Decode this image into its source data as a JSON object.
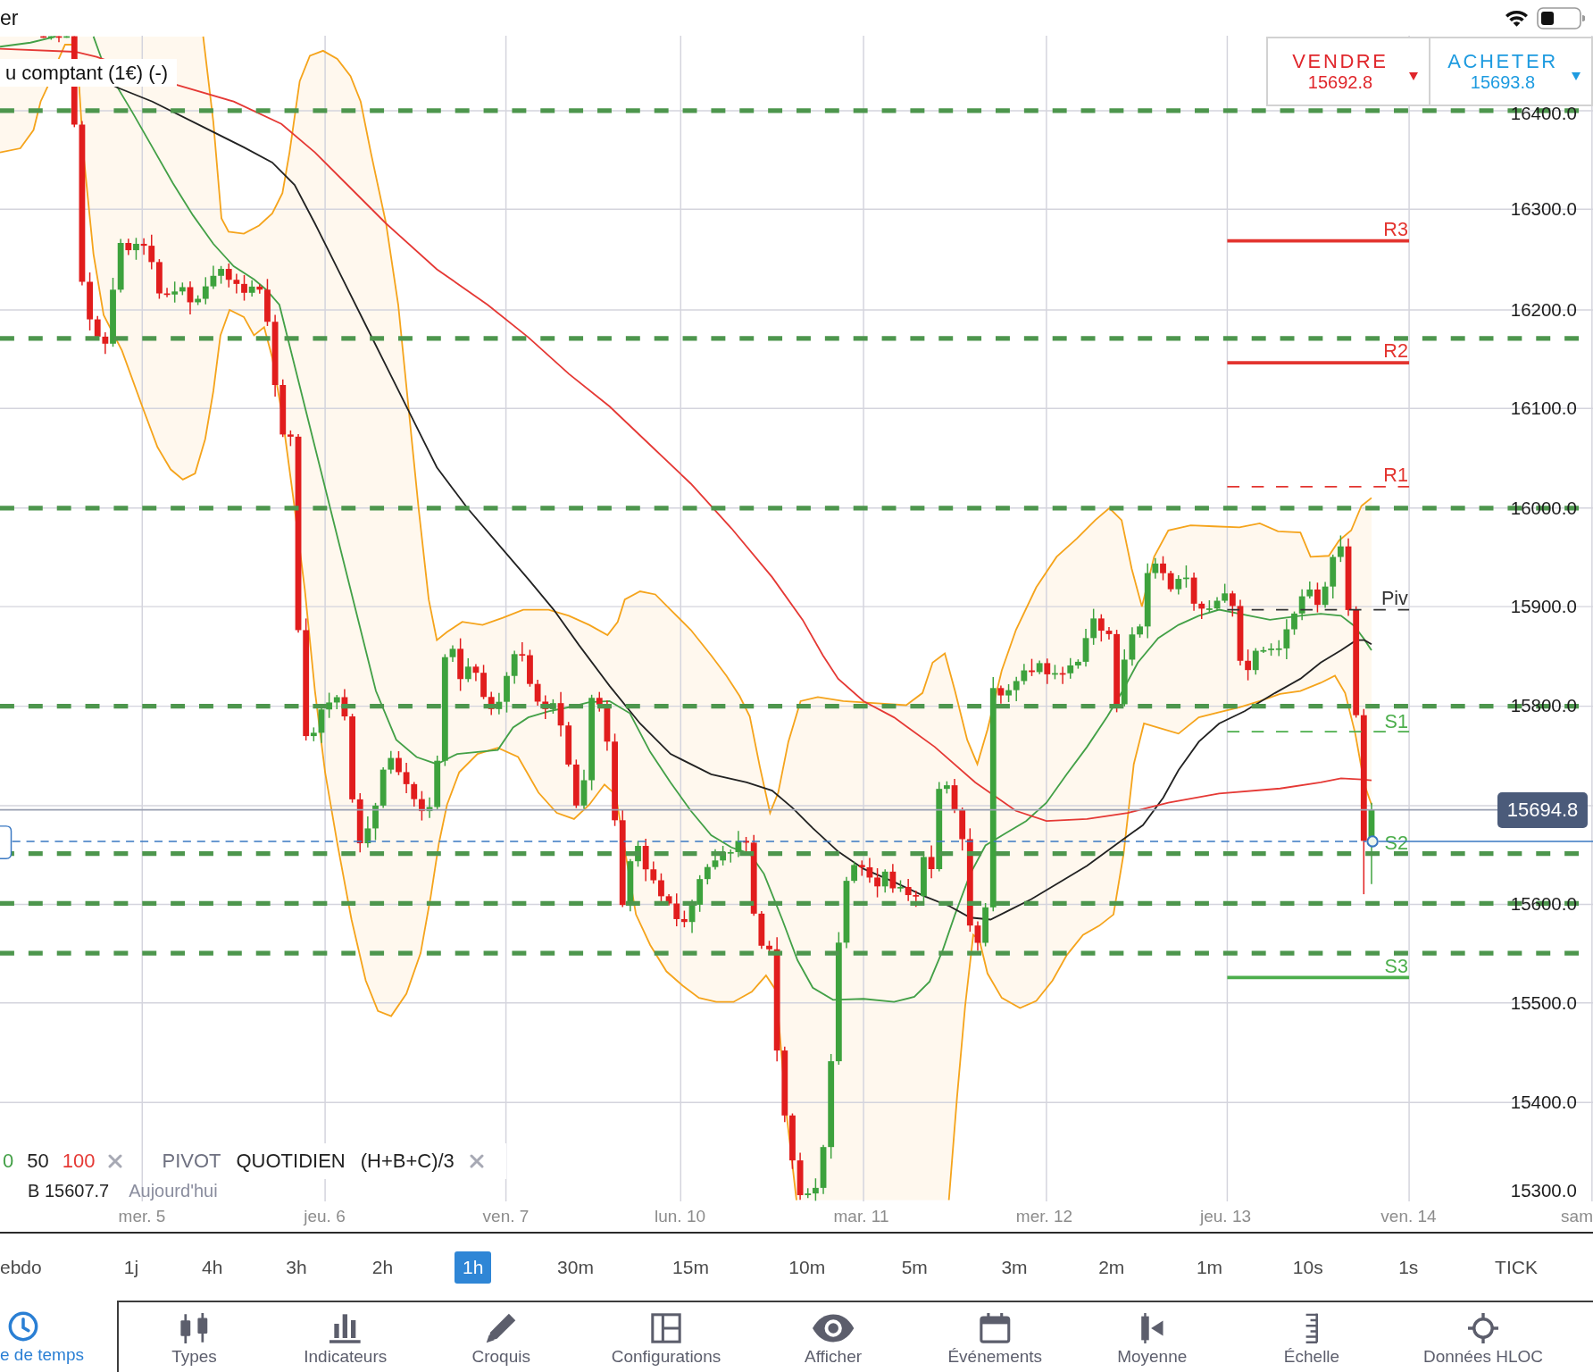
{
  "status_bar": {
    "carrier": "er"
  },
  "chart": {
    "title": "u comptant (1€) (-)",
    "quote": {
      "sell": {
        "label": "VENDRE",
        "price": "15692.8"
      },
      "buy": {
        "label": "ACHETER",
        "price": "15693.8"
      }
    },
    "price_axis": [
      "16400.0",
      "16300.0",
      "16200.0",
      "16100.0",
      "16000.0",
      "15900.0",
      "15800.0",
      "15600.0",
      "15500.0",
      "15400.0",
      "15300.0"
    ],
    "pivot_levels": [
      {
        "label": "R3",
        "color": "#e3342f",
        "dashed": false
      },
      {
        "label": "R2",
        "color": "#e3342f",
        "dashed": false
      },
      {
        "label": "R1",
        "color": "#e3342f",
        "dashed": true
      },
      {
        "label": "Piv",
        "color": "#333333",
        "dashed": true
      },
      {
        "label": "S1",
        "color": "#4cae4c",
        "dashed": true
      },
      {
        "label": "S2",
        "color": "#4cae4c"
      },
      {
        "label": "S3",
        "color": "#4cae4c",
        "dashed": false
      }
    ],
    "current_price": "15694.8",
    "legend": {
      "moving_averages": [
        {
          "label": "0",
          "color": "#43a047"
        },
        {
          "label": "50",
          "color": "#222222"
        },
        {
          "label": "100",
          "color": "#e53935"
        }
      ],
      "pivot": {
        "name": "PIVOT",
        "period": "QUOTIDIEN",
        "formula": "(H+B+C)/3"
      },
      "info": [
        "B 15607.7",
        "Aujourd'hui"
      ]
    },
    "time_axis": [
      "mer. 5",
      "jeu. 6",
      "ven. 7",
      "lun. 10",
      "mar. 11",
      "mer. 12",
      "jeu. 13",
      "ven. 14",
      "sam"
    ]
  },
  "timeframes": [
    {
      "label": "ebdo",
      "selected": false
    },
    {
      "label": "1j",
      "selected": false
    },
    {
      "label": "4h",
      "selected": false
    },
    {
      "label": "3h",
      "selected": false
    },
    {
      "label": "2h",
      "selected": false
    },
    {
      "label": "1h",
      "selected": true
    },
    {
      "label": "30m",
      "selected": false
    },
    {
      "label": "15m",
      "selected": false
    },
    {
      "label": "10m",
      "selected": false
    },
    {
      "label": "5m",
      "selected": false
    },
    {
      "label": "3m",
      "selected": false
    },
    {
      "label": "2m",
      "selected": false
    },
    {
      "label": "1m",
      "selected": false
    },
    {
      "label": "10s",
      "selected": false
    },
    {
      "label": "1s",
      "selected": false
    },
    {
      "label": "TICK",
      "selected": false
    }
  ],
  "toolbar": [
    {
      "label": "e de temps",
      "selected": true
    },
    {
      "label": "Types",
      "selected": false
    },
    {
      "label": "Indicateurs",
      "selected": false
    },
    {
      "label": "Croquis",
      "selected": false
    },
    {
      "label": "Configurations",
      "selected": false
    },
    {
      "label": "Afficher",
      "selected": false
    },
    {
      "label": "Événements",
      "selected": false
    },
    {
      "label": "Moyenne",
      "selected": false
    },
    {
      "label": "Échelle",
      "selected": false
    },
    {
      "label": "Données HLOC",
      "selected": false
    }
  ]
}
